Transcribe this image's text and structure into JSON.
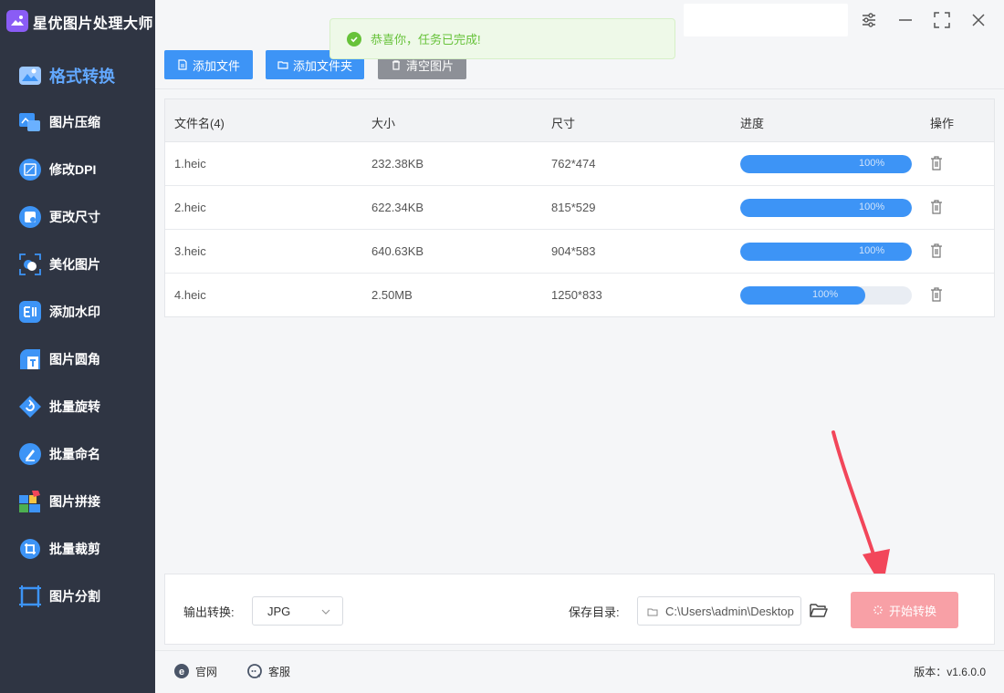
{
  "app": {
    "title": "星优图片处理大师",
    "logo_icon": "image-magic-icon"
  },
  "sidebar": {
    "items": [
      {
        "label": "格式转换",
        "icon": "image-convert-icon",
        "active": true
      },
      {
        "label": "图片压缩",
        "icon": "compress-icon"
      },
      {
        "label": "修改DPI",
        "icon": "dpi-icon"
      },
      {
        "label": "更改尺寸",
        "icon": "resize-icon"
      },
      {
        "label": "美化图片",
        "icon": "beautify-icon"
      },
      {
        "label": "添加水印",
        "icon": "watermark-icon"
      },
      {
        "label": "图片圆角",
        "icon": "round-corner-icon"
      },
      {
        "label": "批量旋转",
        "icon": "rotate-icon"
      },
      {
        "label": "批量命名",
        "icon": "rename-icon"
      },
      {
        "label": "图片拼接",
        "icon": "puzzle-icon"
      },
      {
        "label": "批量裁剪",
        "icon": "crop-icon"
      },
      {
        "label": "图片分割",
        "icon": "split-icon"
      }
    ]
  },
  "toast": {
    "text": "恭喜你，任务已完成!",
    "icon": "check-circle-icon"
  },
  "toolbar": {
    "add_file": "添加文件",
    "add_folder": "添加文件夹",
    "clear": "清空图片"
  },
  "table": {
    "headers": {
      "name": "文件名(4)",
      "size": "大小",
      "dimensions": "尺寸",
      "progress": "进度",
      "action": "操作"
    },
    "rows": [
      {
        "name": "1.heic",
        "size": "232.38KB",
        "dimensions": "762*474",
        "progress": "100%",
        "progress_fraction": 1.0
      },
      {
        "name": "2.heic",
        "size": "622.34KB",
        "dimensions": "815*529",
        "progress": "100%",
        "progress_fraction": 1.0
      },
      {
        "name": "3.heic",
        "size": "640.63KB",
        "dimensions": "904*583",
        "progress": "100%",
        "progress_fraction": 1.0
      },
      {
        "name": "4.heic",
        "size": "2.50MB",
        "dimensions": "1250*833",
        "progress": "100%",
        "progress_fraction": 0.73
      }
    ]
  },
  "bottom": {
    "output_label": "输出转换:",
    "format_value": "JPG",
    "save_label": "保存目录:",
    "save_path": "C:\\Users\\admin\\Desktop",
    "start_label": "开始转换"
  },
  "footer": {
    "website": "官网",
    "support": "客服",
    "version": "版本：v1.6.0.0"
  },
  "colors": {
    "sidebar_bg": "#2f3543",
    "accent": "#3d94f6",
    "active_nav": "#62a8ff",
    "success": "#67c23a",
    "start_button": "#f8a0a6",
    "arrow": "#f2465a"
  }
}
